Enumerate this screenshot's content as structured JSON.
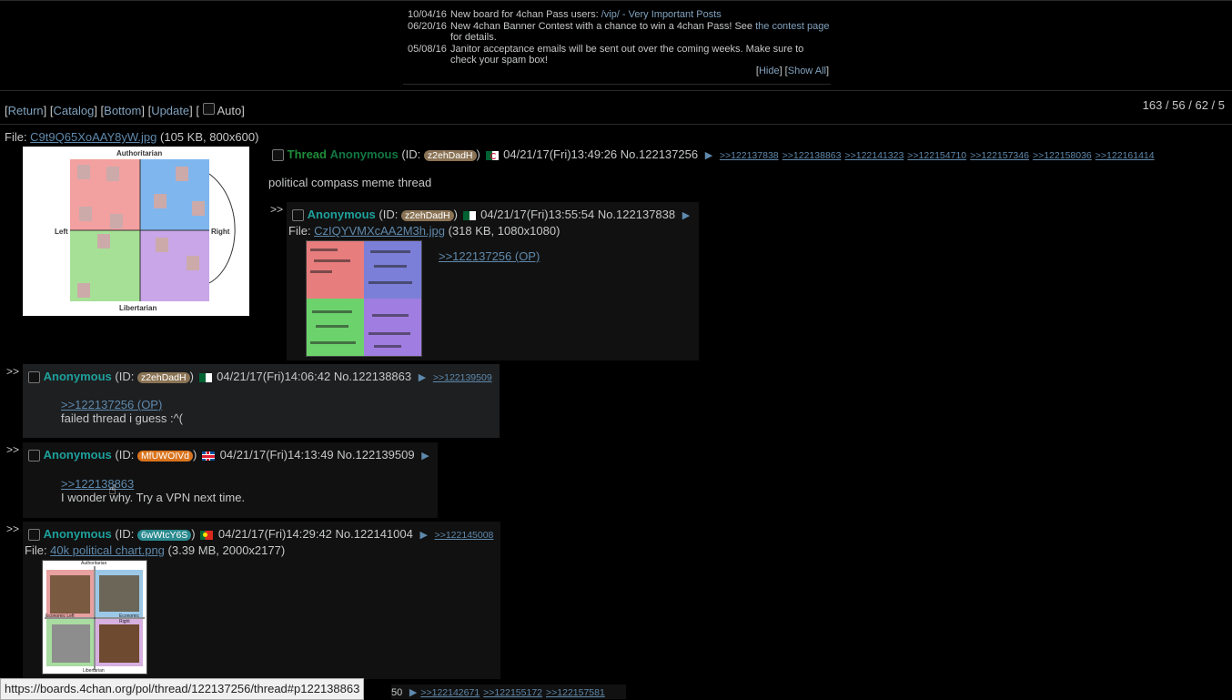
{
  "announcements": [
    {
      "date": "10/04/16",
      "text": "New board for 4chan Pass users: ",
      "link": "/vip/ - Very Important Posts",
      "after": ""
    },
    {
      "date": "06/20/16",
      "text": "New 4chan Banner Contest with a chance to win a 4chan Pass! See ",
      "link": "the contest page",
      "after": " for details."
    },
    {
      "date": "05/08/16",
      "text": "Janitor acceptance emails will be sent out over the coming weeks. Make sure to check your spam box!",
      "link": "",
      "after": ""
    }
  ],
  "ann_controls": {
    "hide": "Hide",
    "show_all": "Show All"
  },
  "nav": {
    "return": "Return",
    "catalog": "Catalog",
    "bottom": "Bottom",
    "update": "Update",
    "auto": "Auto"
  },
  "stats": "163 / 56 / 62 / 5",
  "op": {
    "file_label": "File: ",
    "file_name": "C9t9Q65XoAAY8yW.jpg",
    "file_info": " (105 KB, 800x600)",
    "subject": "Thread",
    "name": "Anonymous",
    "id": "z2ehDadH",
    "datetime": "04/21/17(Fri)13:49:26",
    "no": "No.122137256",
    "replies": [
      ">>122137838",
      ">>122138863",
      ">>122141323",
      ">>122154710",
      ">>122157346",
      ">>122158036",
      ">>122161414"
    ],
    "comment": "political compass meme thread",
    "thumb_labels": {
      "top": "Authoritarian",
      "bottom": "Libertarian",
      "left": "Left",
      "right": "Right"
    }
  },
  "posts": [
    {
      "name": "Anonymous",
      "id": "z2ehDadH",
      "datetime": "04/21/17(Fri)13:55:54",
      "no": "No.122137838",
      "file_label": "File: ",
      "file_name": "CzIQYVMXcAA2M3h.jpg",
      "file_info": " (318 KB, 1080x1080)",
      "quote": ">>122137256 (OP)"
    },
    {
      "name": "Anonymous",
      "id": "z2ehDadH",
      "datetime": "04/21/17(Fri)14:06:42",
      "no": "No.122138863",
      "reply": ">>122139509",
      "quote": ">>122137256 (OP)",
      "comment": "failed thread i guess :^("
    },
    {
      "name": "Anonymous",
      "id": "MfUWOIVd",
      "datetime": "04/21/17(Fri)14:13:49",
      "no": "No.122139509",
      "quote": ">>122138863",
      "comment": "I wonder why. Try a VPN next time."
    },
    {
      "name": "Anonymous",
      "id": "6wWtcY6S",
      "datetime": "04/21/17(Fri)14:29:42",
      "no": "No.122141004",
      "reply": ">>122145008",
      "file_label": "File: ",
      "file_name": "40k political chart.png",
      "file_info": " (3.39 MB, 2000x2177)",
      "thumb_labels": {
        "top": "Authoritarian",
        "bottom": "Libertarian",
        "left": "Economic Left",
        "right": "Economic Right"
      }
    }
  ],
  "partial_post_links": [
    "50",
    ">>122142671",
    ">>122155172",
    ">>122157581"
  ],
  "status_url": "https://boards.4chan.org/pol/thread/122137256/thread#p122138863",
  "colors": {
    "id_tan": "#8a7355",
    "id_orange": "#d9741e",
    "id_teal": "#2a8a8f"
  }
}
